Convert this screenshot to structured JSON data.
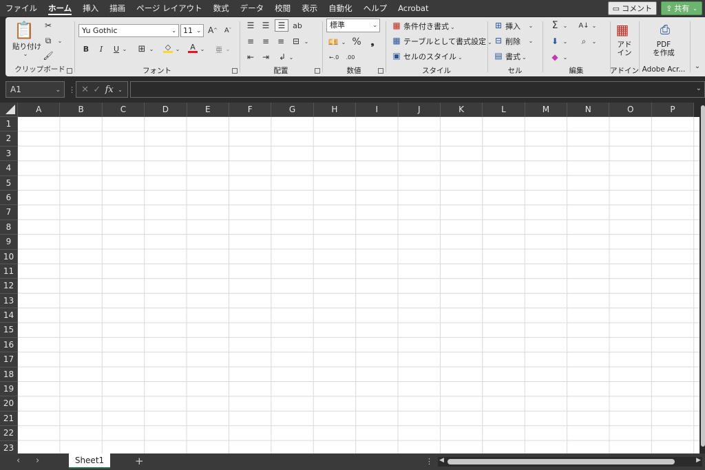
{
  "menu": {
    "tabs": [
      "ファイル",
      "ホーム",
      "挿入",
      "描画",
      "ページ レイアウト",
      "数式",
      "データ",
      "校閲",
      "表示",
      "自動化",
      "ヘルプ",
      "Acrobat"
    ],
    "active_tab": "ホーム",
    "comment_label": "コメント",
    "share_label": "共有"
  },
  "ribbon": {
    "clipboard": {
      "paste_label": "貼り付け",
      "group_label": "クリップボード"
    },
    "font": {
      "font_name": "Yu Gothic",
      "font_size": "11",
      "bold": "B",
      "italic": "I",
      "underline": "U",
      "group_label": "フォント"
    },
    "alignment": {
      "group_label": "配置"
    },
    "number": {
      "format": "標準",
      "percent": "%",
      "comma": "❟",
      "group_label": "数値"
    },
    "styles": {
      "conditional_format": "条件付き書式",
      "format_as_table": "テーブルとして書式設定",
      "cell_styles": "セルのスタイル",
      "group_label": "スタイル"
    },
    "cells": {
      "insert": "挿入",
      "delete": "削除",
      "format": "書式",
      "group_label": "セル"
    },
    "editing": {
      "group_label": "編集"
    },
    "addins": {
      "button_line1": "アド",
      "button_line2": "イン",
      "group_label": "アドイン"
    },
    "adobe": {
      "button_line1": "PDF",
      "button_line2": "を作成",
      "group_label": "Adobe Acr..."
    }
  },
  "formula_bar": {
    "name_box": "A1",
    "fx_label": "fx",
    "formula_value": ""
  },
  "grid": {
    "columns": [
      "A",
      "B",
      "C",
      "D",
      "E",
      "F",
      "G",
      "H",
      "I",
      "J",
      "K",
      "L",
      "M",
      "N",
      "O",
      "P"
    ],
    "rows": [
      "1",
      "2",
      "3",
      "4",
      "5",
      "6",
      "7",
      "8",
      "9",
      "10",
      "11",
      "12",
      "13",
      "14",
      "15",
      "16",
      "17",
      "18",
      "19",
      "20",
      "21",
      "22",
      "23"
    ]
  },
  "sheets": {
    "tabs": [
      "Sheet1"
    ],
    "add_label": "+"
  },
  "colors": {
    "accent_green": "#1e7145",
    "share_green": "#6cb56f",
    "ribbon_bg": "#e6e6e6",
    "chrome_dark": "#2b2b2b"
  }
}
